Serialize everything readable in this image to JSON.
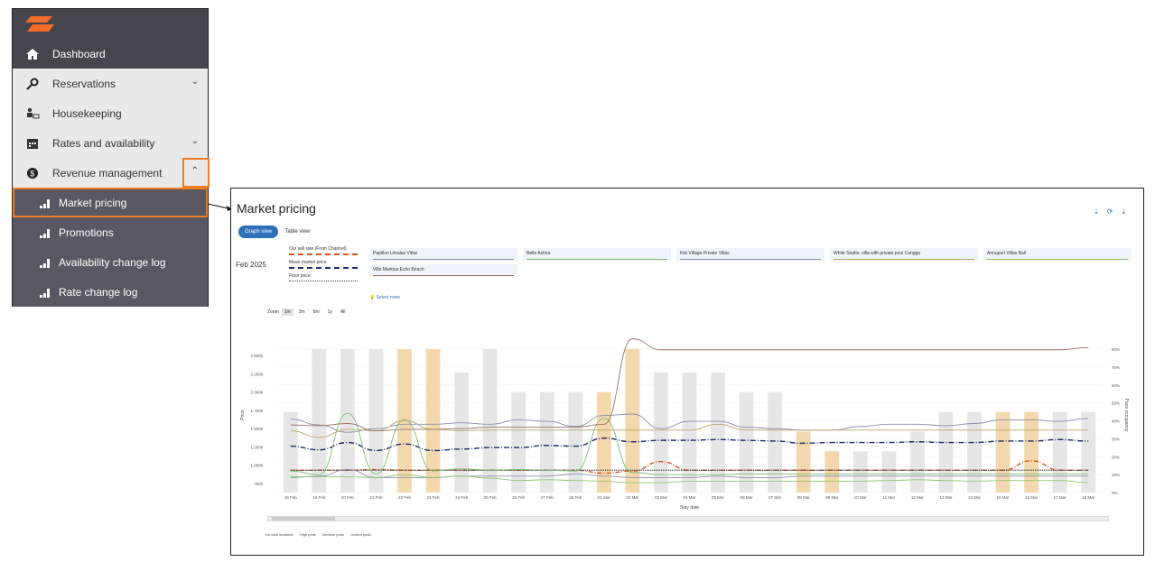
{
  "sidebar": {
    "items": [
      {
        "label": "Dashboard",
        "icon": "home-icon",
        "style": "dark"
      },
      {
        "label": "Reservations",
        "icon": "key-icon",
        "chevron": "down"
      },
      {
        "label": "Housekeeping",
        "icon": "housekeeping-icon"
      },
      {
        "label": "Rates and availability",
        "icon": "calendar-icon",
        "chevron": "down"
      },
      {
        "label": "Revenue management",
        "icon": "dollar-icon",
        "chevron": "up"
      },
      {
        "label": "Market pricing",
        "icon": "bar-chart-icon",
        "style": "sub"
      },
      {
        "label": "Promotions",
        "icon": "bar-chart-icon",
        "style": "sub"
      },
      {
        "label": "Availability change log",
        "icon": "bar-chart-icon",
        "style": "sub"
      },
      {
        "label": "Rate change log",
        "icon": "bar-chart-icon",
        "style": "sub"
      }
    ]
  },
  "panel": {
    "title": "Market pricing",
    "views": [
      "Graph view",
      "Table view"
    ],
    "month": "Feb 2025",
    "legend": [
      "Our sell rate (From Channel)",
      "Mean market price",
      "Floor price"
    ],
    "competitors": [
      {
        "name": "Papillon Umalas Villas",
        "color": "#8a8fa8"
      },
      {
        "name": "Belle Astina",
        "color": "#79c075"
      },
      {
        "name": "Kiki Village Private Villas",
        "color": "#8b8fb0"
      },
      {
        "name": "White Studio, villa with private pool Canggu",
        "color": "#b9a76a"
      },
      {
        "name": "Annupuri Villas Bali",
        "color": "#8fc46f"
      },
      {
        "name": "Villa Markisa Echo Beach",
        "color": "#9b7366"
      }
    ],
    "select_none": "Select none",
    "zoom_label": "Zoom",
    "zoom_options": [
      "1m",
      "3m",
      "6m",
      "1y",
      "All"
    ],
    "bottom_legend": [
      "No data available",
      "High peak",
      "Medium peak",
      "Limited peak"
    ]
  },
  "chart_data": {
    "type": "line",
    "x": [
      "18 Feb",
      "19 Feb",
      "20 Feb",
      "21 Feb",
      "22 Feb",
      "23 Feb",
      "24 Feb",
      "25 Feb",
      "26 Feb",
      "27 Feb",
      "28 Feb",
      "01 Mar",
      "02 Mar",
      "03 Mar",
      "04 Mar",
      "05 Mar",
      "06 Mar",
      "07 Mar",
      "08 Mar",
      "09 Mar",
      "10 Mar",
      "11 Mar",
      "12 Mar",
      "13 Mar",
      "14 Mar",
      "15 Mar",
      "16 Mar",
      "17 Mar",
      "18 Mar"
    ],
    "xlabel": "Stay date",
    "ylabel": "Price",
    "y2label": "Pace occupancy",
    "yticks": [
      "750k",
      "1.000k",
      "1.250k",
      "1.500k",
      "1.750k",
      "2.000k",
      "2.250k",
      "2.500k"
    ],
    "y2ticks": [
      "0%",
      "10%",
      "20%",
      "30%",
      "40%",
      "50%",
      "60%",
      "70%",
      "80%"
    ],
    "occupancy_bars": [
      {
        "v": 45,
        "peak": false
      },
      {
        "v": 80,
        "peak": false
      },
      {
        "v": 80,
        "peak": false
      },
      {
        "v": 80,
        "peak": false
      },
      {
        "v": 80,
        "peak": true
      },
      {
        "v": 80,
        "peak": true
      },
      {
        "v": 67,
        "peak": false
      },
      {
        "v": 80,
        "peak": false
      },
      {
        "v": 56,
        "peak": false
      },
      {
        "v": 56,
        "peak": false
      },
      {
        "v": 56,
        "peak": false
      },
      {
        "v": 56,
        "peak": true
      },
      {
        "v": 80,
        "peak": true
      },
      {
        "v": 67,
        "peak": false
      },
      {
        "v": 67,
        "peak": false
      },
      {
        "v": 67,
        "peak": false
      },
      {
        "v": 56,
        "peak": false
      },
      {
        "v": 56,
        "peak": false
      },
      {
        "v": 34,
        "peak": true
      },
      {
        "v": 23,
        "peak": true
      },
      {
        "v": 23,
        "peak": false
      },
      {
        "v": 23,
        "peak": false
      },
      {
        "v": 34,
        "peak": false
      },
      {
        "v": 45,
        "peak": false
      },
      {
        "v": 45,
        "peak": false
      },
      {
        "v": 45,
        "peak": true
      },
      {
        "v": 45,
        "peak": true
      },
      {
        "v": 45,
        "peak": false
      },
      {
        "v": 45,
        "peak": false
      }
    ],
    "series": [
      {
        "name": "Our sell rate (From Channel)",
        "color": "#d9531e",
        "dash": "5,2,1,2",
        "values": [
          930,
          930,
          930,
          940,
          930,
          930,
          930,
          930,
          930,
          930,
          930,
          890,
          920,
          1050,
          930,
          930,
          930,
          930,
          930,
          930,
          930,
          930,
          930,
          930,
          930,
          930,
          1060,
          930,
          930
        ]
      },
      {
        "name": "Mean market price",
        "color": "#1f2a6b",
        "dash": "6,2,1,2",
        "values": [
          1260,
          1210,
          1310,
          1200,
          1290,
          1200,
          1220,
          1240,
          1240,
          1270,
          1260,
          1370,
          1320,
          1340,
          1340,
          1350,
          1340,
          1330,
          1300,
          1310,
          1310,
          1310,
          1320,
          1310,
          1310,
          1330,
          1330,
          1350,
          1330
        ]
      },
      {
        "name": "Floor price",
        "color": "#444444",
        "dash": "1,1",
        "values": [
          930,
          930,
          930,
          930,
          930,
          930,
          930,
          930,
          930,
          930,
          930,
          930,
          930,
          930,
          930,
          930,
          930,
          930,
          930,
          930,
          930,
          930,
          930,
          930,
          930,
          930,
          930,
          930,
          930
        ]
      },
      {
        "name": "Papillon Umalas Villas",
        "color": "#8a8fa8",
        "values": [
          1630,
          1550,
          1450,
          1500,
          1560,
          1560,
          1580,
          1560,
          1620,
          1600,
          1530,
          1680,
          1700,
          1500,
          1600,
          1600,
          1520,
          1500,
          1480,
          1480,
          1530,
          1560,
          1560,
          1540,
          1570,
          1620,
          1620,
          1600,
          1640
        ]
      },
      {
        "name": "Belle Astina",
        "color": "#79c075",
        "values": [
          920,
          870,
          1710,
          880,
          1620,
          920,
          950,
          930,
          940,
          930,
          920,
          1640,
          900,
          870,
          870,
          870,
          880,
          880,
          880,
          880,
          880,
          880,
          880,
          880,
          880,
          880,
          880,
          880,
          880
        ]
      },
      {
        "name": "Kiki Village Private Villas",
        "color": "#8b8fb0",
        "values": [
          830,
          850,
          940,
          830,
          830,
          830,
          850,
          850,
          850,
          850,
          880,
          850,
          830,
          830,
          830,
          850,
          830,
          830,
          850,
          850,
          850,
          850,
          850,
          850,
          850,
          850,
          850,
          850,
          850
        ]
      },
      {
        "name": "White Studio, villa with private pool Canggu",
        "color": "#b9a76a",
        "values": [
          1470,
          1380,
          1490,
          1470,
          1610,
          1490,
          1470,
          1480,
          1480,
          1480,
          1480,
          1480,
          1480,
          1480,
          1480,
          1560,
          1480,
          1480,
          1480,
          1480,
          1480,
          1480,
          1480,
          1480,
          1480,
          1480,
          1480,
          1480,
          1480
        ]
      },
      {
        "name": "Annupuri Villas Bali",
        "color": "#8fc46f",
        "values": [
          840,
          840,
          840,
          830,
          870,
          830,
          850,
          820,
          790,
          800,
          790,
          780,
          760,
          760,
          780,
          780,
          780,
          780,
          780,
          780,
          780,
          790,
          800,
          790,
          780,
          790,
          790,
          790,
          760
        ]
      },
      {
        "name": "Villa Markisa Echo Beach",
        "color": "#9b7366",
        "values": [
          1550,
          1540,
          1570,
          1470,
          1490,
          1490,
          1500,
          1520,
          1520,
          1520,
          1520,
          1560,
          2730,
          2580,
          2580,
          2580,
          2580,
          2580,
          2580,
          2580,
          2580,
          2580,
          2580,
          2580,
          2580,
          2580,
          2580,
          2580,
          2610
        ]
      }
    ]
  }
}
